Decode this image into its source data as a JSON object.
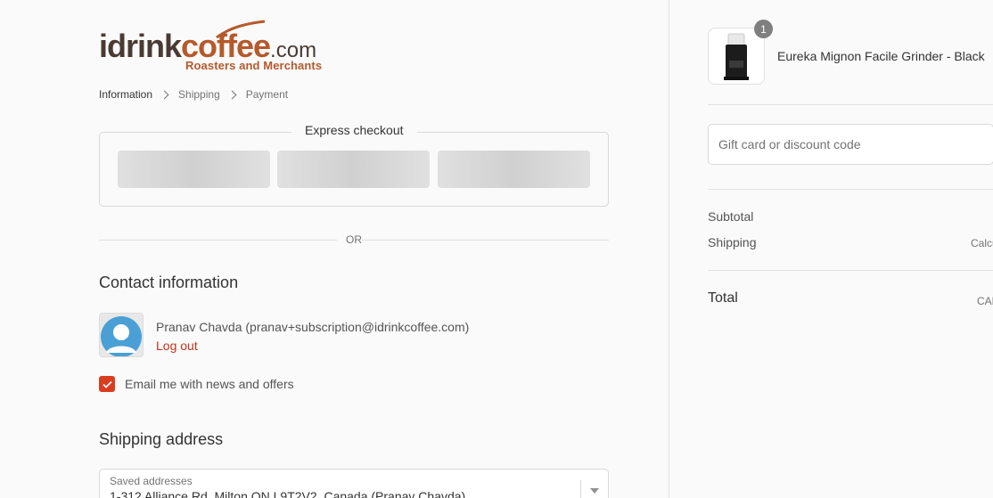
{
  "brand": {
    "logo_part1": "idrink",
    "logo_part2": "coffee",
    "logo_part3": ".com",
    "tagline": "Roasters and Merchants"
  },
  "breadcrumb": [
    "Information",
    "Shipping",
    "Payment"
  ],
  "express": {
    "title": "Express checkout"
  },
  "divider": {
    "or_text": "OR"
  },
  "contact": {
    "heading": "Contact information",
    "user_line": "Pranav Chavda (pranav+subscription@idrinkcoffee.com)",
    "logout_label": "Log out",
    "newsletter_label": "Email me with news and offers",
    "newsletter_checked": true
  },
  "shipping": {
    "heading": "Shipping address",
    "saved_label": "Saved addresses",
    "saved_value": "1-312 Alliance Rd, Milton ON L9T2V2, Canada (Pranav Chavda)"
  },
  "order": {
    "quantity": "1",
    "product_name": "Eureka Mignon Facile Grinder - Black",
    "discount_placeholder": "Gift card or discount code",
    "subtotal_label": "Subtotal",
    "shipping_label": "Shipping",
    "shipping_value": "Calcu",
    "total_label": "Total",
    "total_value": "CAD"
  },
  "colors": {
    "accent": "#d93c1f",
    "link": "#c6321b",
    "brand_orange": "#b6592b",
    "brand_brown": "#4a3a33"
  }
}
